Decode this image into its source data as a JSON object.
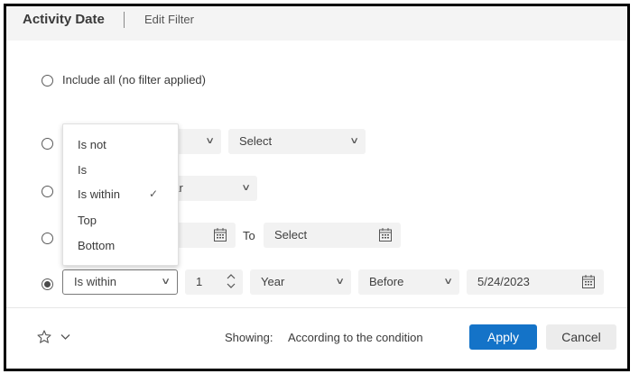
{
  "header": {
    "title": "Activity Date",
    "edit_filter": "Edit Filter"
  },
  "options": {
    "include_all": "Include all (no filter applied)",
    "row1": {
      "value2": "Select"
    },
    "row2": {
      "partial": "ear"
    },
    "row3": {
      "to": "To",
      "value2": "Select"
    },
    "row4": {
      "operator": "Is within",
      "amount": "1",
      "unit": "Year",
      "direction": "Before",
      "date": "5/24/2023"
    }
  },
  "dropdown": {
    "items": [
      "Is not",
      "Is",
      "Is within",
      "Top",
      "Bottom"
    ],
    "checked": "Is within"
  },
  "footer": {
    "showing_label": "Showing:",
    "showing_value": "According to the condition",
    "apply": "Apply",
    "cancel": "Cancel"
  },
  "colors": {
    "accent": "#1473c8"
  }
}
